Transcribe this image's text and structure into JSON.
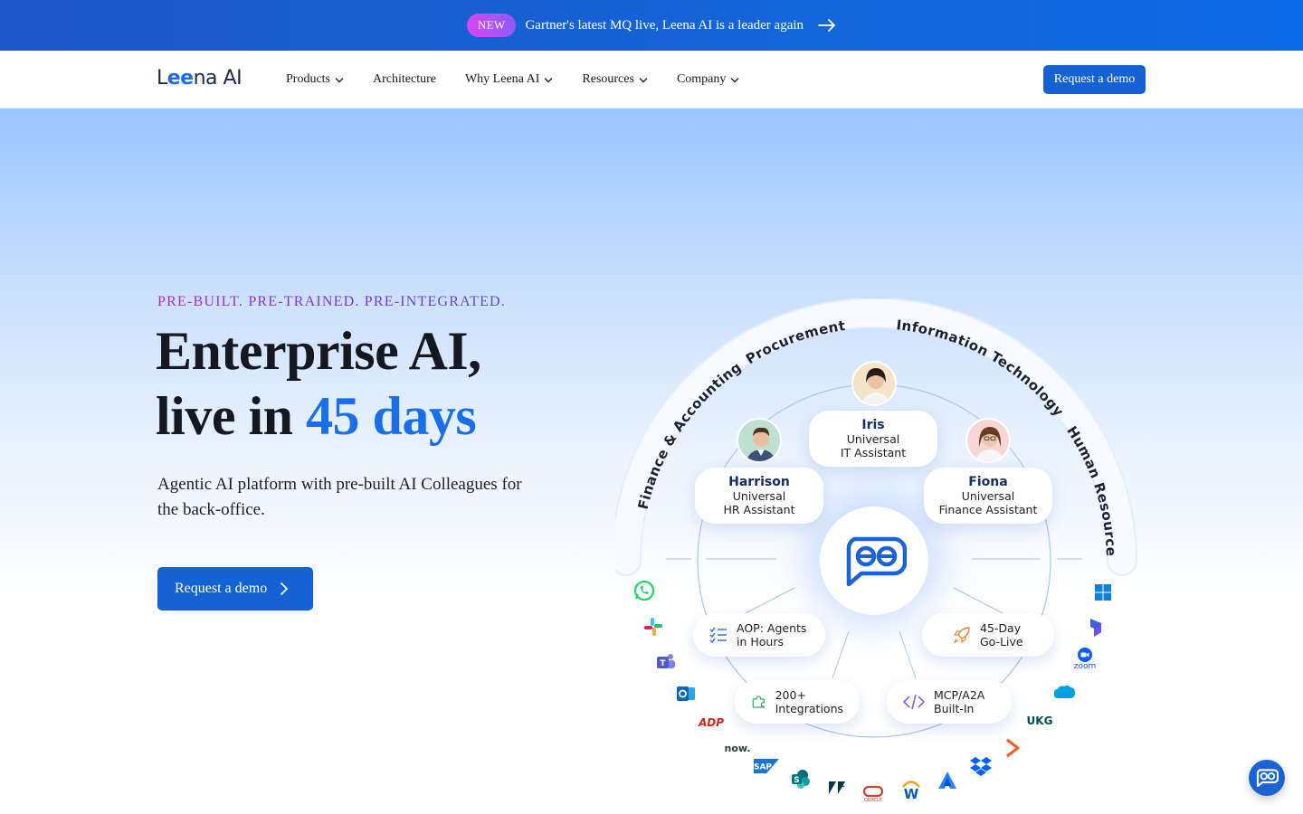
{
  "announcement": {
    "badge": "NEW",
    "text": "Gartner's latest MQ live, Leena AI is a leader again"
  },
  "nav": {
    "logo_prefix": "L",
    "logo_mid": "ee",
    "logo_suffix": "na AI",
    "items": [
      {
        "label": "Products",
        "dropdown": true
      },
      {
        "label": "Architecture",
        "dropdown": false
      },
      {
        "label": "Why Leena AI",
        "dropdown": true
      },
      {
        "label": "Resources",
        "dropdown": true
      },
      {
        "label": "Company",
        "dropdown": true
      }
    ],
    "cta": "Request a demo"
  },
  "hero": {
    "eyebrow": "PRE-BUILT. PRE-TRAINED. PRE-INTEGRATED.",
    "headline_line1": "Enterprise AI,",
    "headline_line2_prefix": "live in ",
    "headline_highlight": "45 days",
    "subline": "Agentic AI platform with pre-built AI Colleagues for the back-office.",
    "cta": "Request a demo"
  },
  "diagram": {
    "arc_labels": [
      "Finance & Accounting",
      "Procurement",
      "Information Technology",
      "Human Resources"
    ],
    "assistants": [
      {
        "name": "Iris",
        "role_line1": "Universal",
        "role_line2": "IT Assistant"
      },
      {
        "name": "Harrison",
        "role_line1": "Universal",
        "role_line2": "HR Assistant"
      },
      {
        "name": "Fiona",
        "role_line1": "Universal",
        "role_line2": "Finance Assistant"
      }
    ],
    "features": [
      {
        "line1": "AOP: Agents",
        "line2": "in Hours",
        "icon": "checklist-icon"
      },
      {
        "line1": "45-Day",
        "line2": "Go-Live",
        "icon": "rocket-icon"
      },
      {
        "line1": "200+",
        "line2": "Integrations",
        "icon": "puzzle-icon"
      },
      {
        "line1": "MCP/A2A",
        "line2": "Built-In",
        "icon": "code-icon"
      }
    ],
    "integration_labels": {
      "adp": "ADP",
      "now": "now.",
      "sap": "SAP",
      "ukg": "UKG",
      "zoom": "zoom",
      "oracle": "ORACLE",
      "workday": "W"
    }
  },
  "colors": {
    "brand_blue": "#1462d4",
    "highlight_blue": "#1a6fe8",
    "eyebrow_purple": "#b02cc7"
  }
}
